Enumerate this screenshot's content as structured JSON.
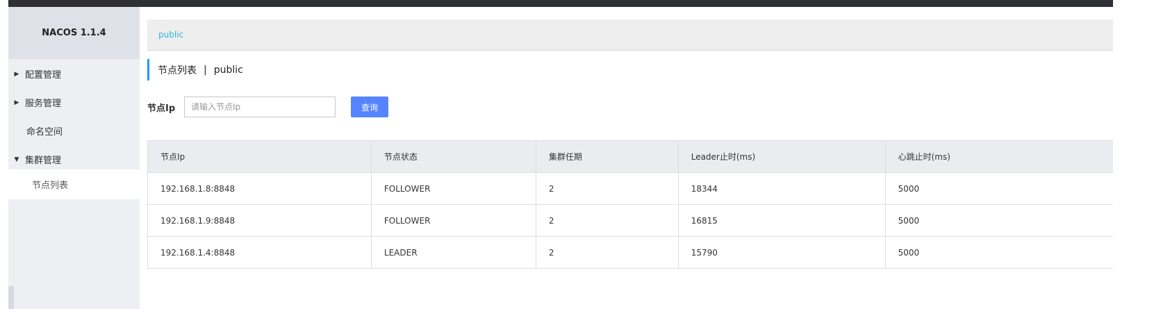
{
  "app": {
    "brand": "NACOS 1.1.4"
  },
  "sidebar": {
    "items": [
      {
        "label": "配置管理",
        "caret": "▶"
      },
      {
        "label": "服务管理",
        "caret": "▶"
      },
      {
        "label": "命名空间",
        "caret": ""
      },
      {
        "label": "集群管理",
        "caret": "▼"
      },
      {
        "label": "节点列表",
        "caret": ""
      }
    ]
  },
  "breadcrumb": {
    "namespace": "public"
  },
  "page": {
    "title": "节点列表",
    "separator": "|",
    "namespace": "public"
  },
  "search": {
    "label": "节点Ip",
    "placeholder": "请输入节点Ip",
    "button_label": "查询"
  },
  "table": {
    "headers": [
      "节点Ip",
      "节点状态",
      "集群任期",
      "Leader止时(ms)",
      "心跳止时(ms)"
    ],
    "rows": [
      [
        "192.168.1.8:8848",
        "FOLLOWER",
        "2",
        "18344",
        "5000"
      ],
      [
        "192.168.1.9:8848",
        "FOLLOWER",
        "2",
        "16815",
        "5000"
      ],
      [
        "192.168.1.4:8848",
        "LEADER",
        "2",
        "15790",
        "5000"
      ]
    ]
  },
  "colors": {
    "accent": "#209bfa",
    "primary_button": "#5584ff",
    "link": "#35b5d8"
  }
}
